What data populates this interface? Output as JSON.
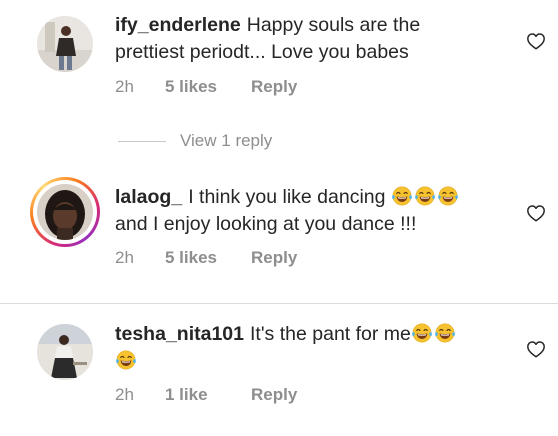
{
  "comments": [
    {
      "username": "ify_enderlene",
      "text_lines": [
        "Happy souls are the",
        "prettiest periodt... Love you babes"
      ],
      "time": "2h",
      "likes": "5 likes",
      "reply": "Reply",
      "has_story_ring": false
    },
    {
      "username": "lalaog_",
      "text_line1": "I think you like dancing",
      "text_line2": "and I enjoy looking at you dance !!!",
      "emoji_line1": [
        "face-with-tears-of-joy",
        "face-with-tears-of-joy",
        "face-with-tears-of-joy"
      ],
      "time": "2h",
      "likes": "5 likes",
      "reply": "Reply",
      "has_story_ring": true
    },
    {
      "username": "tesha_nita101",
      "text_line1": "It's the pant for me",
      "emoji_line1": [
        "face-with-tears-of-joy",
        "face-with-tears-of-joy"
      ],
      "emoji_line2": [
        "face-with-tears-of-joy"
      ],
      "time": "2h",
      "likes": "1 like",
      "reply": "Reply",
      "has_story_ring": false
    }
  ],
  "view_replies": "View 1 reply",
  "icons": {
    "like": "heart-outline-icon",
    "emoji": "face-with-tears-of-joy"
  },
  "colors": {
    "text": "#262626",
    "secondary": "#8e8e8e",
    "emoji_face": "#f7c22f",
    "tears": "#4fb3e8",
    "ring_start": "#fa7e1e",
    "ring_end": "#d62976"
  }
}
